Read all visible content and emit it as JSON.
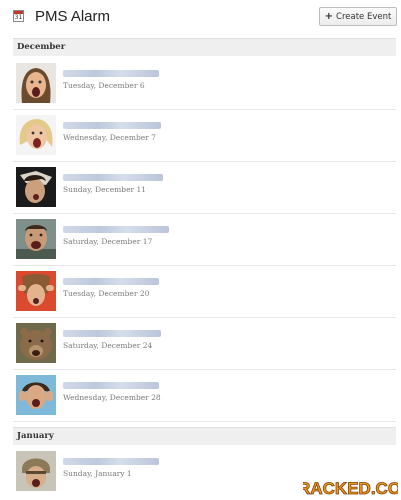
{
  "app": {
    "title": "PMS Alarm",
    "calendar_icon_day": "31",
    "create_label": "Create Event"
  },
  "months": [
    {
      "label": "December"
    },
    {
      "label": "January"
    }
  ],
  "events": [
    {
      "date": "Tuesday, December 6",
      "photo": "screaming-woman-photo"
    },
    {
      "date": "Wednesday, December 7",
      "photo": "screaming-blonde-woman-photo"
    },
    {
      "date": "Sunday, December 11",
      "photo": "woman-holding-head-photo"
    },
    {
      "date": "Saturday, December 17",
      "photo": "man-yelling-photo"
    },
    {
      "date": "Tuesday, December 20",
      "photo": "woman-pulling-hair-photo"
    },
    {
      "date": "Saturday, December 24",
      "photo": "growling-bear-photo"
    },
    {
      "date": "Wednesday, December 28",
      "photo": "woman-covering-ears-photo"
    },
    {
      "date": "Sunday, January 1",
      "photo": "man-in-helmet-photo"
    }
  ],
  "watermark": {
    "text": "CRACKED.COM"
  },
  "colors": {
    "accent_red": "#c0392b",
    "watermark_orange": "#f29a1e",
    "blurred_title": "#b3bfd8"
  }
}
